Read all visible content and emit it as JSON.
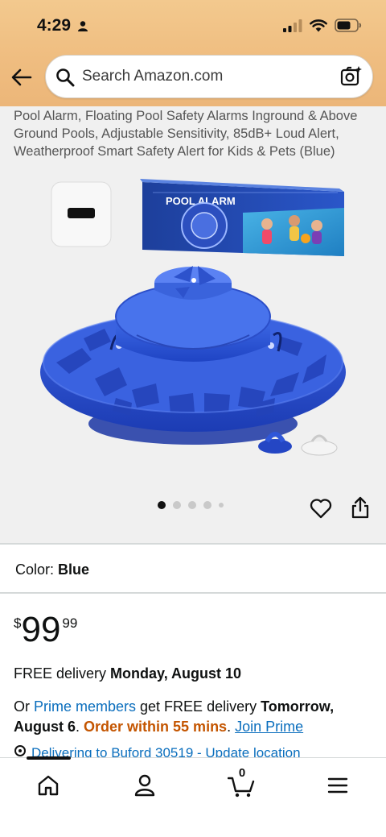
{
  "status_bar": {
    "time": "4:29"
  },
  "search": {
    "placeholder": "Search Amazon.com"
  },
  "product": {
    "title": "Pool Alarm, Floating Pool Safety Alarms Inground & Above Ground Pools, Adjustable Sensitivity, 85dB+ Loud Alert, Weatherproof Smart Safety Alert for Kids & Pets (Blue)",
    "box_label": "POOL ALARM",
    "image_count": 5,
    "active_image": 1
  },
  "color": {
    "label": "Color:",
    "value": "Blue"
  },
  "price": {
    "symbol": "$",
    "whole": "99",
    "fraction": "99"
  },
  "delivery": {
    "prefix": "FREE delivery ",
    "date": "Monday, August 10"
  },
  "prime": {
    "or": "Or ",
    "members_link": "Prime members",
    "middle": " get FREE delivery ",
    "date": "Tomorrow, August 6",
    "period": ". ",
    "order_within": "Order within 55 mins",
    "period2": ". ",
    "join_link": "Join Prime"
  },
  "deliver_to": {
    "text": "Delivering to Buford 30519 - Update location"
  },
  "nav": {
    "cart_count": "0"
  },
  "colors": {
    "header_bg": "#efbd80",
    "link": "#0a6ebd",
    "urgent": "#c45500",
    "product_blue": "#2f57d9"
  }
}
